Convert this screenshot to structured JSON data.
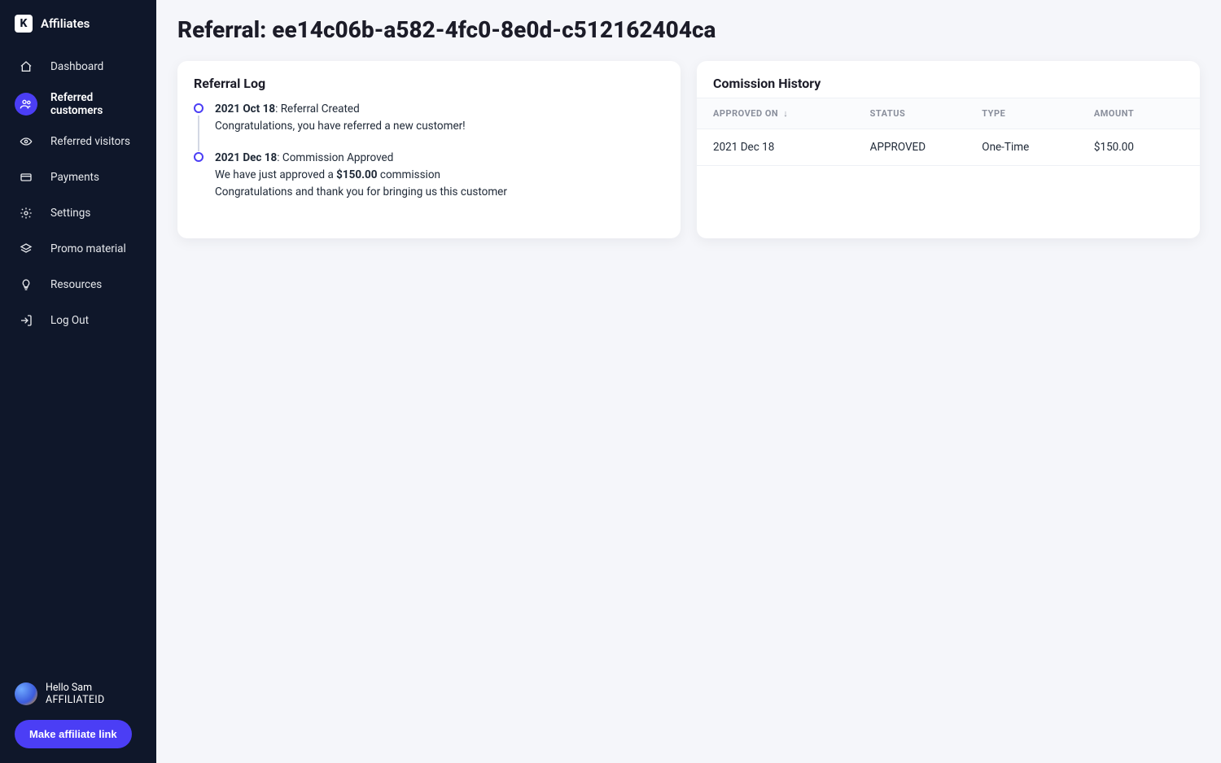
{
  "brand": {
    "logo_letter": "K",
    "name": "Affiliates"
  },
  "sidebar": {
    "items": [
      {
        "label": "Dashboard",
        "icon": "home"
      },
      {
        "label": "Referred customers",
        "icon": "users",
        "active": true
      },
      {
        "label": "Referred visitors",
        "icon": "eye"
      },
      {
        "label": "Payments",
        "icon": "card"
      },
      {
        "label": "Settings",
        "icon": "gear"
      },
      {
        "label": "Promo material",
        "icon": "layers"
      },
      {
        "label": "Resources",
        "icon": "bulb"
      },
      {
        "label": "Log Out",
        "icon": "logout"
      }
    ],
    "user": {
      "hello": "Hello Sam",
      "affiliate_id": "AFFILIATEID"
    },
    "make_link_label": "Make affiliate link"
  },
  "page": {
    "title": "Referral: ee14c06b-a582-4fc0-8e0d-c512162404ca"
  },
  "referral_log": {
    "title": "Referral Log",
    "items": [
      {
        "date": "2021 Oct 18",
        "headline": "Referral Created",
        "body": "Congratulations, you have referred a new customer!"
      },
      {
        "date": "2021 Dec 18",
        "headline": "Commission Approved",
        "body_pre": "We have just approved a ",
        "body_bold": "$150.00",
        "body_post": " commission",
        "body_line2": "Congratulations and thank you for bringing us this customer"
      }
    ]
  },
  "commission_history": {
    "title": "Comission History",
    "columns": {
      "approved_on": "APPROVED ON",
      "status": "STATUS",
      "type": "TYPE",
      "amount": "AMOUNT"
    },
    "sort_indicator": "↓",
    "rows": [
      {
        "approved_on": "2021 Dec 18",
        "status": "APPROVED",
        "type": "One-Time",
        "amount": "$150.00"
      }
    ]
  }
}
